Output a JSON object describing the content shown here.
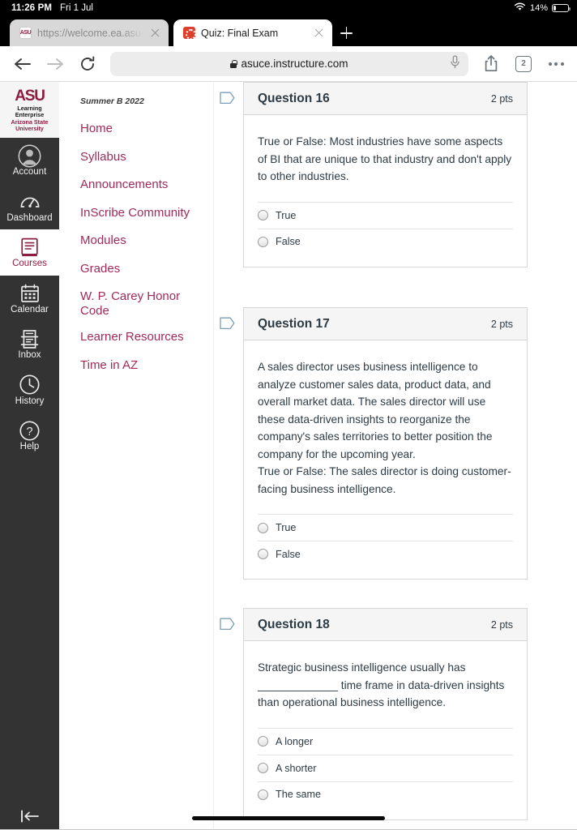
{
  "status_bar": {
    "time": "11:26 PM",
    "date": "Fri 1 Jul",
    "wifi_icon": "wifi-icon",
    "battery_percent": "14%"
  },
  "browser": {
    "tabs": [
      {
        "favicon": "asu-favicon",
        "title": "https://welcome.ea.asu.e",
        "active": false,
        "close_icon": "close-icon"
      },
      {
        "favicon": "canvas-favicon",
        "title": "Quiz: Final Exam",
        "active": true,
        "close_icon": "close-icon"
      }
    ],
    "new_tab_label": "+",
    "toolbar": {
      "back_icon": "back-arrow-icon",
      "forward_icon": "forward-arrow-icon",
      "reload_icon": "reload-icon",
      "lock_icon": "lock-icon",
      "url": "asuce.instructure.com",
      "mic_icon": "microphone-icon",
      "share_icon": "share-icon",
      "tab_count": "2",
      "more_icon": "more-dots-icon"
    }
  },
  "global_nav": {
    "logo": {
      "mark": "ASU",
      "line1": "Learning\nEnterprise",
      "line2": "Arizona State\nUniversity"
    },
    "items": [
      {
        "label": "Account",
        "icon": "account-avatar-icon",
        "active": false
      },
      {
        "label": "Dashboard",
        "icon": "dashboard-icon",
        "active": false
      },
      {
        "label": "Courses",
        "icon": "courses-book-icon",
        "active": true
      },
      {
        "label": "Calendar",
        "icon": "calendar-icon",
        "active": false
      },
      {
        "label": "Inbox",
        "icon": "inbox-icon",
        "active": false
      },
      {
        "label": "History",
        "icon": "history-clock-icon",
        "active": false
      },
      {
        "label": "Help",
        "icon": "help-question-icon",
        "active": false
      }
    ],
    "collapse_icon": "collapse-left-icon"
  },
  "course_nav": {
    "term": "Summer B 2022",
    "links": [
      "Home",
      "Syllabus",
      "Announcements",
      "InScribe Community",
      "Modules",
      "Grades",
      "W. P. Carey Honor Code",
      "Learner Resources",
      "Time in AZ"
    ]
  },
  "quiz": {
    "flag_icon": "flag-bookmark-icon",
    "questions": [
      {
        "title": "Question 16",
        "points": "2 pts",
        "text": "True or False: Most industries have some aspects of BI that are unique to that industry and don't apply to other industries.",
        "answers": [
          "True",
          "False"
        ]
      },
      {
        "title": "Question 17",
        "points": "2 pts",
        "text": "A sales director uses business intelligence to analyze customer sales data, product data, and overall market data. The sales director will use these data-driven insights to reorganize the company's sales territories to better position the company for the upcoming year.\nTrue or False: The sales director is doing customer-facing business intelligence.",
        "answers": [
          "True",
          "False"
        ]
      },
      {
        "title": "Question 18",
        "points": "2 pts",
        "text": "Strategic business intelligence usually has _____________ time frame in data-driven insights than operational business intelligence.",
        "answers": [
          "A longer",
          "A shorter",
          "The same"
        ]
      }
    ]
  },
  "colors": {
    "asu_maroon": "#8c1d40",
    "link_maroon": "#a02b5a",
    "canvas_text": "#2d3b45",
    "nav_dark": "#333333",
    "flag_blue": "#73a1b8"
  }
}
